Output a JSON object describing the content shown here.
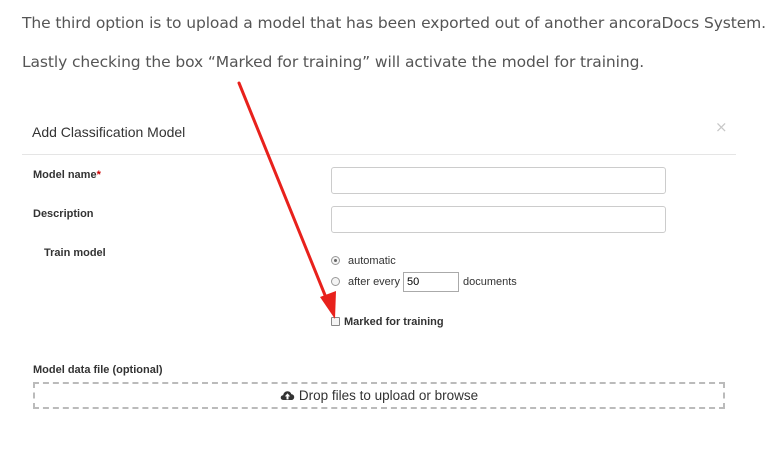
{
  "doc": {
    "paragraph1": "The third option is to upload a model that has been exported out of another ancoraDocs System.",
    "paragraph2": "Lastly checking the box “Marked for training” will activate the model for training."
  },
  "modal": {
    "title": "Add Classification Model",
    "close": "×",
    "model_name_label": "Model name",
    "required_mark": "*",
    "model_name_value": "",
    "description_label": "Description",
    "description_value": "",
    "train_model_label": "Train model",
    "train_option_automatic": "automatic",
    "train_option_after_every": "after every",
    "train_every_value": "50",
    "train_option_documents": "documents",
    "selected_train_option": "automatic",
    "marked_for_training_label": "Marked for training",
    "marked_for_training_checked": false,
    "model_file_label": "Model data file (optional)",
    "dropzone_text": "Drop files to upload or browse"
  },
  "colors": {
    "annotation_arrow": "#e8211c"
  },
  "icons": {
    "close": "close-icon",
    "upload": "cloud-upload-icon"
  }
}
